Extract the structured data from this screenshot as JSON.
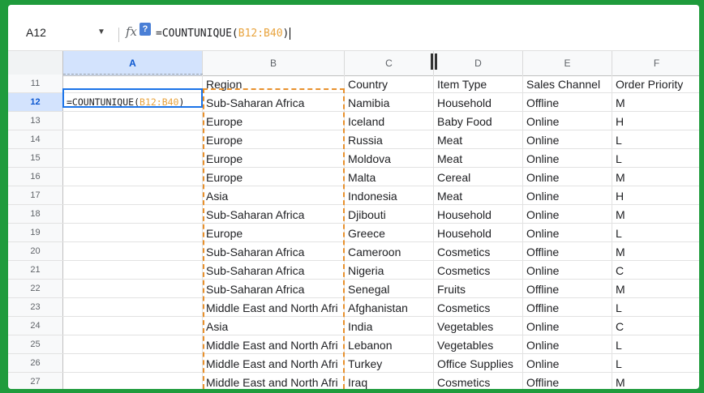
{
  "formula_bar": {
    "name_box": "A12",
    "fx_label": "fx",
    "help_badge": "?",
    "formula_prefix": "=COUNTUNIQUE(",
    "formula_ref": "B12:B40",
    "formula_suffix": ")"
  },
  "columns": [
    "A",
    "B",
    "C",
    "D",
    "E",
    "F"
  ],
  "active_cell": {
    "prefix": "=COUNTUNIQUE(",
    "ref": "B12:B40",
    "suffix": ")"
  },
  "rows": [
    {
      "num": "11",
      "cells": [
        "",
        "Region",
        "Country",
        "Item Type",
        "Sales Channel",
        "Order Priority"
      ]
    },
    {
      "num": "12",
      "cells": [
        "",
        "Sub-Saharan Africa",
        "Namibia",
        "Household",
        "Offline",
        "M"
      ]
    },
    {
      "num": "13",
      "cells": [
        "",
        "Europe",
        "Iceland",
        "Baby Food",
        "Online",
        "H"
      ]
    },
    {
      "num": "14",
      "cells": [
        "",
        "Europe",
        "Russia",
        "Meat",
        "Online",
        "L"
      ]
    },
    {
      "num": "15",
      "cells": [
        "",
        "Europe",
        "Moldova",
        "Meat",
        "Online",
        "L"
      ]
    },
    {
      "num": "16",
      "cells": [
        "",
        "Europe",
        "Malta",
        "Cereal",
        "Online",
        "M"
      ]
    },
    {
      "num": "17",
      "cells": [
        "",
        "Asia",
        "Indonesia",
        "Meat",
        "Online",
        "H"
      ]
    },
    {
      "num": "18",
      "cells": [
        "",
        "Sub-Saharan Africa",
        "Djibouti",
        "Household",
        "Online",
        "M"
      ]
    },
    {
      "num": "19",
      "cells": [
        "",
        "Europe",
        "Greece",
        "Household",
        "Online",
        "L"
      ]
    },
    {
      "num": "20",
      "cells": [
        "",
        "Sub-Saharan Africa",
        "Cameroon",
        "Cosmetics",
        "Offline",
        "M"
      ]
    },
    {
      "num": "21",
      "cells": [
        "",
        "Sub-Saharan Africa",
        "Nigeria",
        "Cosmetics",
        "Online",
        "C"
      ]
    },
    {
      "num": "22",
      "cells": [
        "",
        "Sub-Saharan Africa",
        "Senegal",
        "Fruits",
        "Offline",
        "M"
      ]
    },
    {
      "num": "23",
      "cells": [
        "",
        "Middle East and North Afri",
        "Afghanistan",
        "Cosmetics",
        "Offline",
        "L"
      ]
    },
    {
      "num": "24",
      "cells": [
        "",
        "Asia",
        "India",
        "Vegetables",
        "Online",
        "C"
      ]
    },
    {
      "num": "25",
      "cells": [
        "",
        "Middle East and North Afri",
        "Lebanon",
        "Vegetables",
        "Online",
        "L"
      ]
    },
    {
      "num": "26",
      "cells": [
        "",
        "Middle East and North Afri",
        "Turkey",
        "Office Supplies",
        "Online",
        "L"
      ]
    },
    {
      "num": "27",
      "cells": [
        "",
        "Middle East and North Afri",
        "Iraq",
        "Cosmetics",
        "Offline",
        "M"
      ]
    }
  ],
  "colors": {
    "selection": "#1a73e8",
    "range_highlight": "#e8912d",
    "frame": "#1f9b3c"
  }
}
